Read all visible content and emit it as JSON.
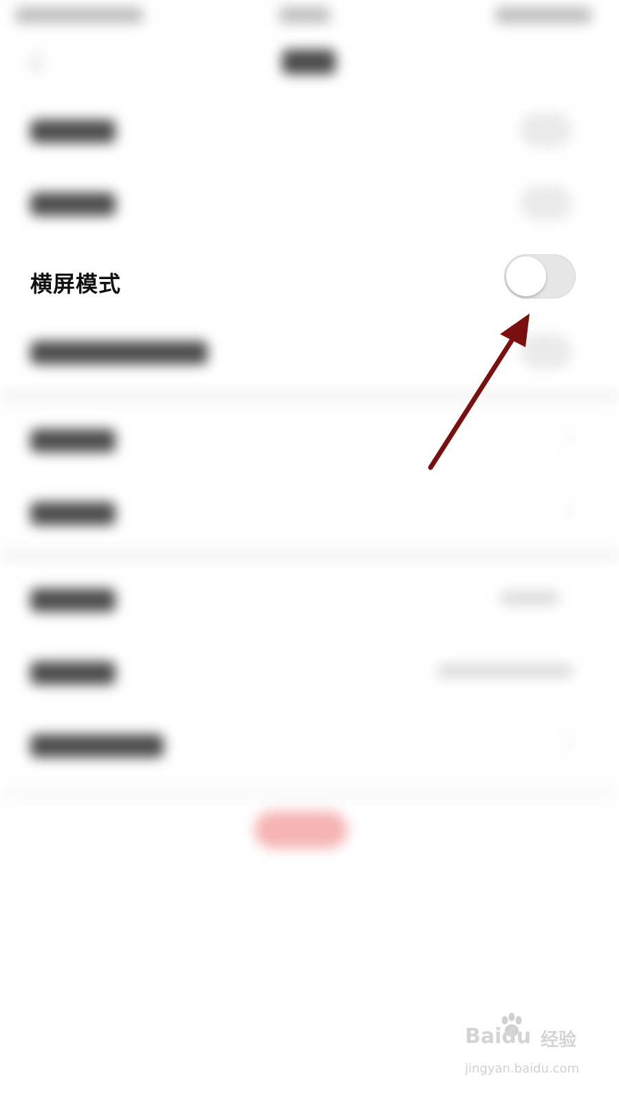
{
  "settings": {
    "focused_row": {
      "label": "横屏模式",
      "toggle_on": false
    }
  },
  "colors": {
    "background": "#ffffff",
    "label_text": "#111111",
    "toggle_track_off": "#e6e6e6",
    "toggle_knob": "#ffffff",
    "annotation_arrow": "#7a0f0f",
    "bottom_button": "#f39a9a"
  },
  "watermark": {
    "brand": "Baidu",
    "brand_cn": "经验",
    "url": "jingyan.baidu.com"
  }
}
